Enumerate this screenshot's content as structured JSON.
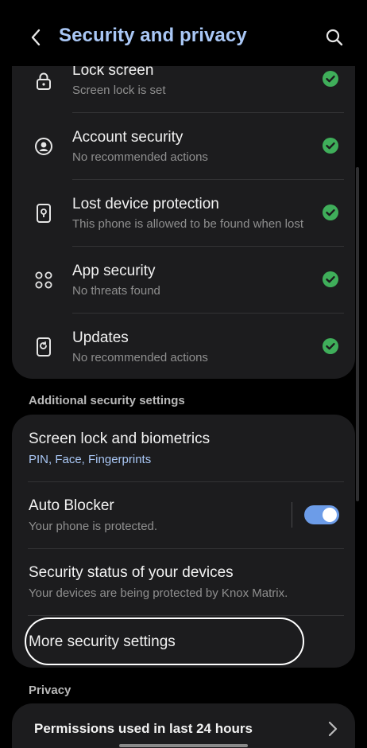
{
  "header": {
    "title": "Security and privacy",
    "back_icon": "chevron-left-icon",
    "search_icon": "search-icon"
  },
  "status_items": [
    {
      "title": "Lock screen",
      "subtitle": "Screen lock is set",
      "icon": "lock-icon",
      "status": "ok"
    },
    {
      "title": "Account security",
      "subtitle": "No recommended actions",
      "icon": "account-icon",
      "status": "ok"
    },
    {
      "title": "Lost device protection",
      "subtitle": "This phone is allowed to be found when lost",
      "icon": "device-icon",
      "status": "ok"
    },
    {
      "title": "App security",
      "subtitle": "No threats found",
      "icon": "apps-icon",
      "status": "ok"
    },
    {
      "title": "Updates",
      "subtitle": "No recommended actions",
      "icon": "update-icon",
      "status": "ok"
    }
  ],
  "additional": {
    "section_label": "Additional security settings",
    "items": [
      {
        "title": "Screen lock and biometrics",
        "subtitle": "PIN, Face, Fingerprints"
      },
      {
        "title": "Auto Blocker",
        "subtitle": "Your phone is protected.",
        "toggle": true
      },
      {
        "title": "Security status of your devices",
        "subtitle": "Your devices are being protected by Knox Matrix."
      },
      {
        "title": "More security settings"
      }
    ]
  },
  "privacy": {
    "section_label": "Privacy",
    "items": [
      {
        "title": "Permissions used in last 24 hours"
      }
    ]
  },
  "colors": {
    "background": "#000000",
    "card": "#1c1c1e",
    "accent": "#a9c7f5",
    "toggle_on": "#6c9ce8",
    "status_ok": "#3fae5a"
  }
}
